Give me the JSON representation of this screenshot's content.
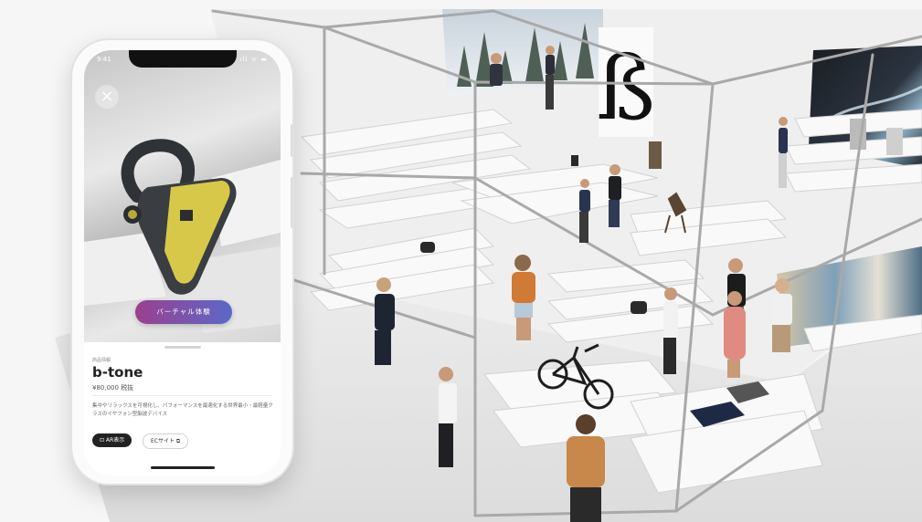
{
  "brand": {
    "logo_glyph": "ß"
  },
  "phone": {
    "status_time": "9:41",
    "status_icons": "ıll ᯤ ▬",
    "close_icon": "×",
    "ar_button_label": "バーチャル体験",
    "product": {
      "category": "商品情報",
      "name": "b-tone",
      "price": "¥80,000 税抜",
      "description": "集中やリラックスを可視化し、パフォーマンスを最適化する世界最小・最軽量クラスのイヤフォン型脳波デバイス",
      "ar_view_label": "⊡ AR表示",
      "ec_site_label": "ECサイト ⧉"
    }
  },
  "colors": {
    "ar_gradient_start": "#9b3f8f",
    "ar_gradient_end": "#5c68c8",
    "device_yellow": "#d8c84a",
    "device_gray": "#3c3f44"
  }
}
